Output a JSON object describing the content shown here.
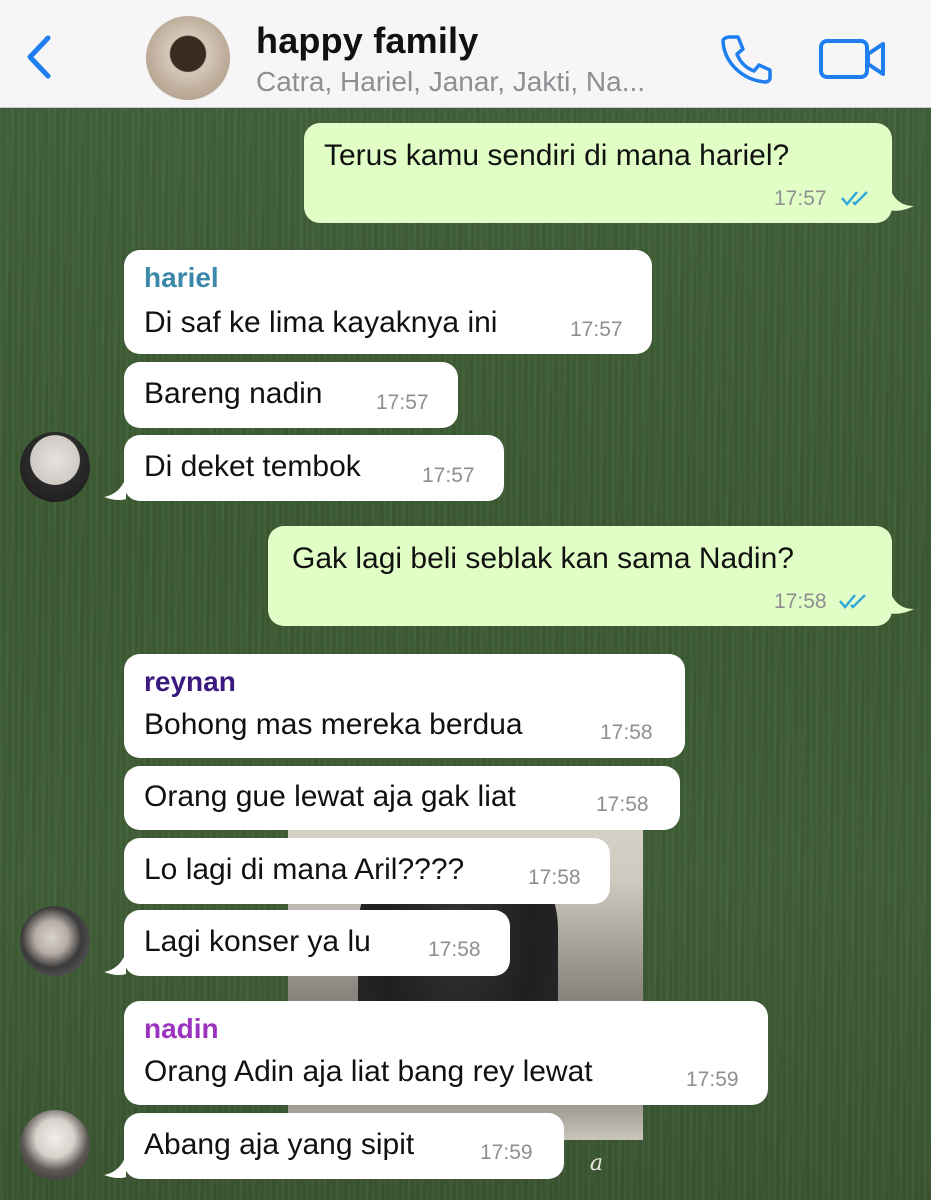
{
  "header": {
    "back_icon": "chevron-left-icon",
    "title": "happy family",
    "members": "Catra, Hariel, Janar, Jakti, Na...",
    "call_icon": "phone-icon",
    "video_icon": "video-camera-icon",
    "accent_color": "#1f7ff0"
  },
  "colors": {
    "incoming_bubble": "#ffffff",
    "outgoing_bubble": "#e1fec6",
    "read_ticks": "#34aadc",
    "sender_hariel": "#3b88a8",
    "sender_reynan": "#3a1a7e",
    "sender_nadin": "#9b33c0"
  },
  "messages": [
    {
      "sender": "",
      "text": "Terus kamu sendiri di mana hariel?",
      "time": "17:57"
    },
    {
      "sender": "hariel",
      "text": "Di saf ke lima kayaknya ini",
      "time": "17:57"
    },
    {
      "sender": "",
      "text": "Bareng nadin",
      "time": "17:57"
    },
    {
      "sender": "",
      "text": "Di deket tembok",
      "time": "17:57"
    },
    {
      "sender": "",
      "text": "Gak lagi beli seblak kan sama Nadin?",
      "time": "17:58"
    },
    {
      "sender": "reynan",
      "text": "Bohong mas mereka berdua",
      "time": "17:58"
    },
    {
      "sender": "",
      "text": "Orang gue lewat aja gak liat",
      "time": "17:58"
    },
    {
      "sender": "",
      "text": "Lo lagi di mana Aril????",
      "time": "17:58"
    },
    {
      "sender": "",
      "text": "Lagi konser ya lu",
      "time": "17:58"
    },
    {
      "sender": "nadin",
      "text": "Orang Adin aja liat bang rey lewat",
      "time": "17:59"
    },
    {
      "sender": "",
      "text": "Abang aja yang sipit",
      "time": "17:59"
    }
  ],
  "wallpaper": {
    "glyph": "a"
  }
}
